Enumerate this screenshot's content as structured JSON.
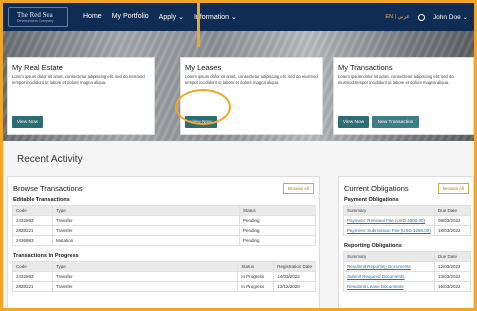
{
  "header": {
    "logo_line1": "The Red Sea",
    "logo_line2": "Development Company",
    "nav": [
      "Home",
      "My Portfolio",
      "Apply",
      "Information"
    ],
    "lang": "EN | عربي",
    "user": "John Doe"
  },
  "cards": [
    {
      "title": "My Real Estate",
      "text": "Lorem ipsum dolor sit amet, consectetur adipiscing elit, sed do eiusmod tempor incididunt ut labore et dolore magna aliqua.",
      "button": "View Now"
    },
    {
      "title": "My Leases",
      "text": "Lorem ipsum dolor sit amet, consectetur adipiscing elit, sed do eiusmod tempor incididunt ut labore et dolore magna aliqua.",
      "button": "View Now"
    },
    {
      "title": "My Transactions",
      "text": "Lorem ipsum dolor sit amet, consectetur adipiscing elit, sed do eiusmod tempor incididunt ut labore et dolore magna aliqua.",
      "button": "View Now",
      "button2": "New Transaction"
    }
  ],
  "recent": {
    "title": "Recent Activity",
    "browse": {
      "title": "Browse Transactions",
      "browse_all": "Browse All",
      "editable": {
        "title": "Editable Transactions",
        "headers": [
          "Code",
          "Type",
          "Status"
        ],
        "rows": [
          [
            "2432893",
            "Transfer",
            "Pending"
          ],
          [
            "2838221",
            "Transfer",
            "Pending"
          ],
          [
            "2436983",
            "Mutation",
            "Pending"
          ]
        ]
      },
      "inprogress": {
        "title": "Transactions In Progress",
        "headers": [
          "Code",
          "Type",
          "Status",
          "Registration Date"
        ],
        "rows": [
          [
            "2432893",
            "Transfer",
            "In Progress",
            "14/03/2022"
          ],
          [
            "2838221",
            "Transfer",
            "In Progress",
            "12/12/2020"
          ]
        ]
      }
    },
    "obligations": {
      "title": "Current Obligations",
      "browse_all": "Browse All",
      "payment": {
        "title": "Payment Obligations",
        "headers": [
          "Summary",
          "Due Date"
        ],
        "rows": [
          [
            "Payment: Renewal Fee (USD 4500.00)",
            "08/03/2022"
          ],
          [
            "Payment: Submission Fee (USD 1250.00)",
            "18/03/2022"
          ]
        ]
      },
      "reporting": {
        "title": "Reporting Obligations",
        "headers": [
          "Summary",
          "Due Date"
        ],
        "rows": [
          [
            "Resubmit Reporting Documents",
            "12/03/2022"
          ],
          [
            "Submit Required Documents",
            "13/03/2022"
          ],
          [
            "Resubmit Lease Documents",
            "16/03/2022"
          ]
        ]
      }
    }
  }
}
